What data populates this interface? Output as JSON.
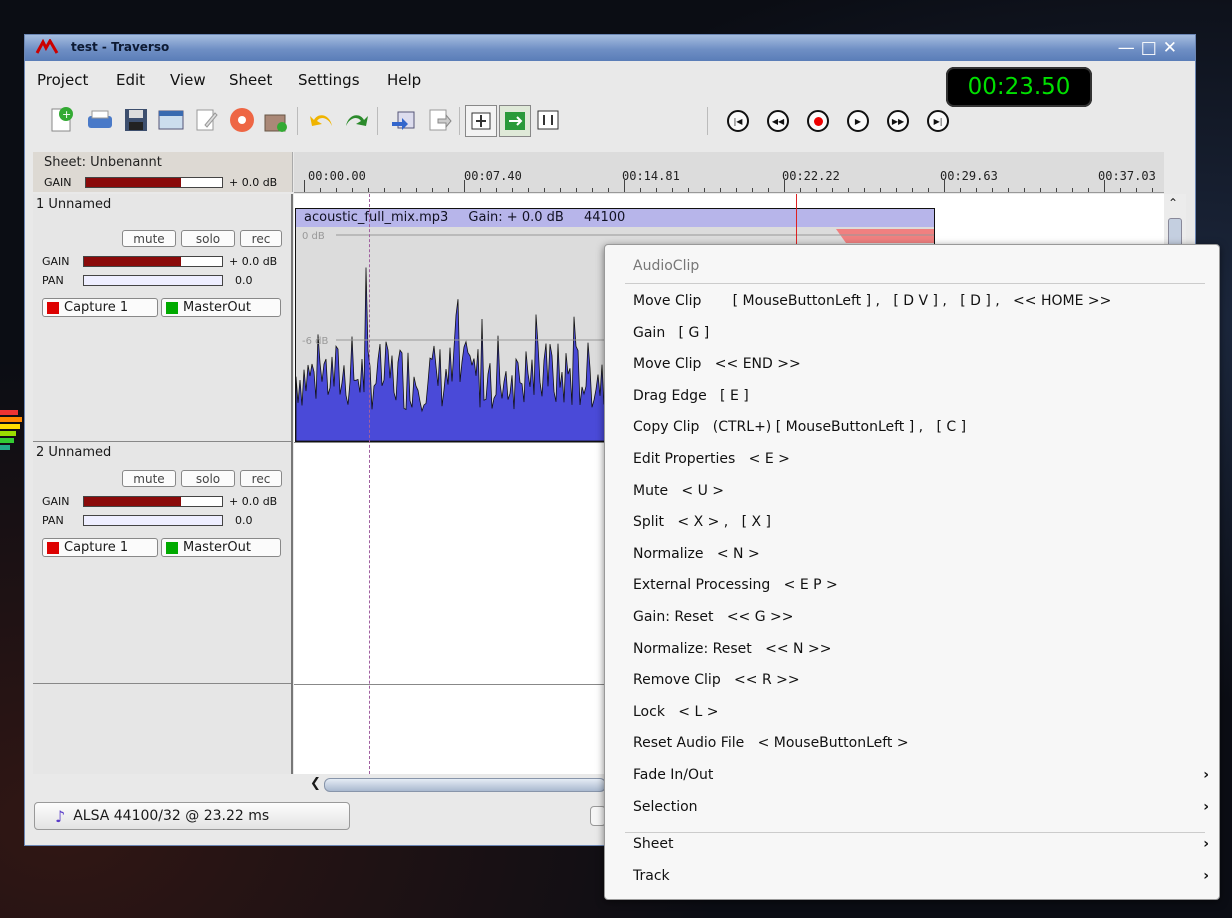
{
  "window": {
    "title": "test - Traverso"
  },
  "menu": [
    "Project",
    "Edit",
    "View",
    "Sheet",
    "Settings",
    "Help"
  ],
  "transport": {
    "time": "00:23.50",
    "buttons": [
      "skip-start-icon",
      "rewind-icon",
      "record-icon",
      "play-icon",
      "fast-forward-icon",
      "skip-end-icon"
    ]
  },
  "sheet": {
    "label": "Sheet: Unbenannt",
    "gain_label": "GAIN",
    "gain_value": "+ 0.0 dB",
    "gain_level": 0.7
  },
  "ruler": [
    "00:00.00",
    "00:07.40",
    "00:14.81",
    "00:22.22",
    "00:29.63",
    "00:37.03"
  ],
  "tracks": [
    {
      "name": "1  Unnamed",
      "mute": "mute",
      "solo": "solo",
      "rec": "rec",
      "gain_label": "GAIN",
      "gain_value": "+ 0.0 dB",
      "pan_label": "PAN",
      "pan_value": "0.0",
      "input": "Capture 1",
      "output": "MasterOut"
    },
    {
      "name": "2  Unnamed",
      "mute": "mute",
      "solo": "solo",
      "rec": "rec",
      "gain_label": "GAIN",
      "gain_value": "+ 0.0 dB",
      "pan_label": "PAN",
      "pan_value": "0.0",
      "input": "Capture 1",
      "output": "MasterOut"
    }
  ],
  "clip": {
    "file": "acoustic_full_mix.mp3",
    "gain": "Gain: + 0.0 dB",
    "rate": "44100",
    "db_top": "0 dB",
    "db_mid": "-6 dB"
  },
  "status": {
    "driver": "ALSA   44100/32 @ 23.22 ms"
  },
  "context_menu": {
    "title": "AudioClip",
    "items": [
      "Move Clip       [ MouseButtonLeft ] ,   [ D V ] ,   [ D ] ,   << HOME >>",
      "Gain   [ G ]",
      "Move Clip   << END >>",
      "Drag Edge   [ E ]",
      "Copy Clip   (CTRL+) [ MouseButtonLeft ] ,   [ C ]",
      "Edit Properties   < E >",
      "Mute   < U >",
      "Split   < X > ,   [ X ]",
      "Normalize   < N >",
      "External Processing   < E P >",
      "Gain: Reset   << G >>",
      "Normalize: Reset   << N >>",
      "Remove Clip   << R >>",
      "Lock   < L >",
      "Reset Audio File   < MouseButtonLeft >"
    ],
    "submenus": [
      "Fade In/Out",
      "Selection"
    ],
    "submenus2": [
      "Sheet",
      "Track"
    ]
  }
}
